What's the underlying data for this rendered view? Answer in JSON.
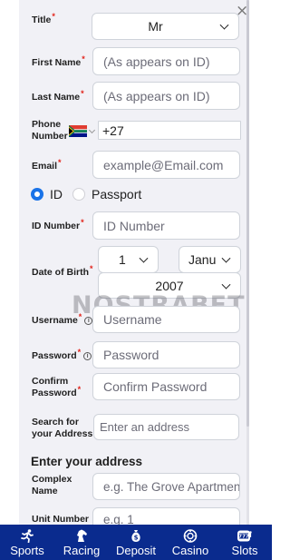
{
  "form": {
    "title_label": "Title",
    "title_value": "Mr",
    "first_name_label": "First Name",
    "first_name_placeholder": "(As appears on ID)",
    "last_name_label": "Last Name",
    "last_name_placeholder": "(As appears on ID)",
    "phone_label_1": "Phone",
    "phone_label_2": "Number",
    "phone_value": "+27",
    "email_label": "Email",
    "email_placeholder": "example@Email.com",
    "id_type_id": "ID",
    "id_type_passport": "Passport",
    "id_number_label": "ID Number",
    "id_number_placeholder": "ID Number",
    "dob_label": "Date of Birth",
    "dob_day": "1",
    "dob_month": "Janu",
    "dob_year": "2007",
    "username_label": "Username",
    "username_placeholder": "Username",
    "password_label": "Password",
    "password_placeholder": "Password",
    "confirm_label_1": "Confirm",
    "confirm_label_2": "Password",
    "confirm_placeholder": "Confirm Password",
    "search_label_1": "Search for",
    "search_label_2": "your Address",
    "search_placeholder": "Enter an address",
    "address_heading": "Enter your address",
    "complex_label_1": "Complex",
    "complex_label_2": "Name",
    "complex_placeholder": "e.g. The Grove Apartments",
    "unit_label": "Unit Number",
    "unit_placeholder": "e.g. 1",
    "required_mark": "*",
    "info_glyph": "i"
  },
  "watermark": "NOSTRABET",
  "close_glyph": "×",
  "nav": [
    {
      "label": "Sports",
      "icon": "running-person-icon"
    },
    {
      "label": "Racing",
      "icon": "horse-icon"
    },
    {
      "label": "Deposit",
      "icon": "money-bag-icon"
    },
    {
      "label": "Casino",
      "icon": "casino-chip-icon"
    },
    {
      "label": "Slots",
      "icon": "slot-777-icon"
    }
  ],
  "colors": {
    "accent": "#1a73e8",
    "required": "#e2231a",
    "nav_background": "#0a2b8e",
    "form_background": "#f1f1f6"
  }
}
